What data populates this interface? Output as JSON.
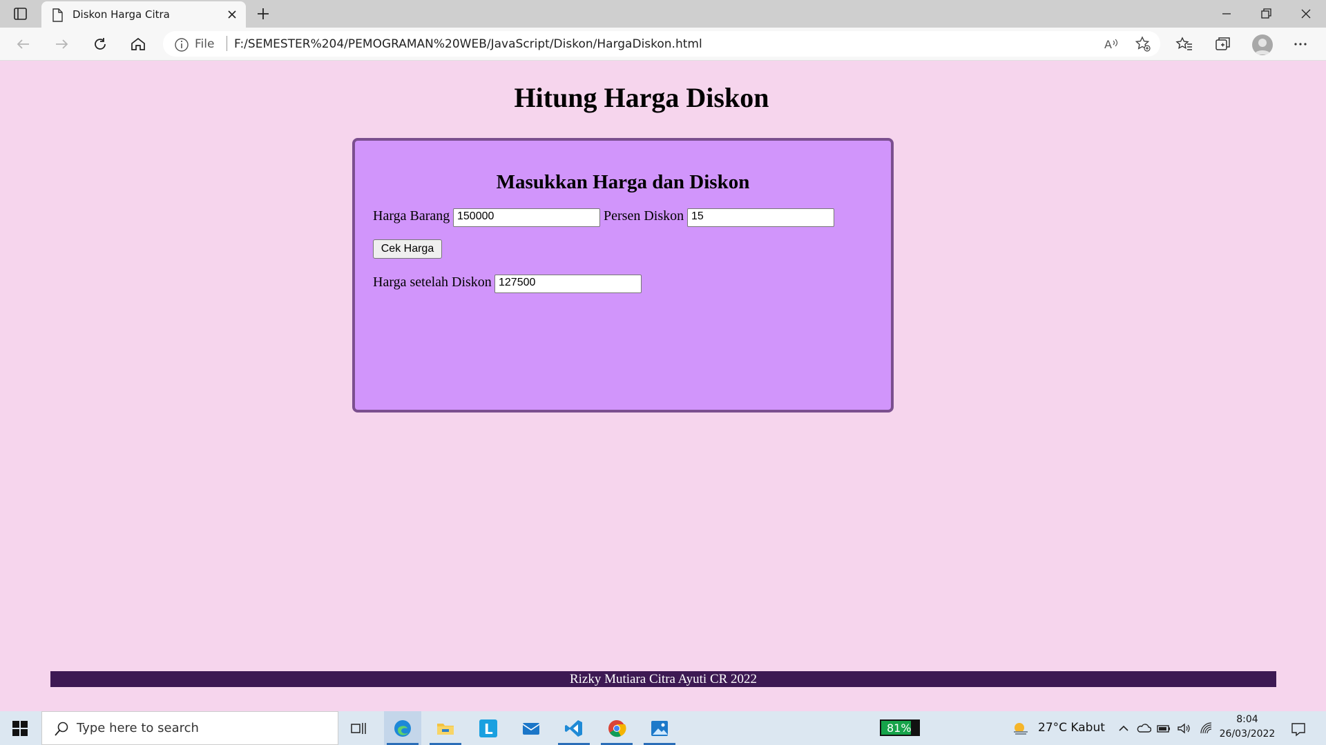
{
  "browser": {
    "tab_title": "Diskon Harga Citra",
    "address_prefix": "File",
    "url": "F:/SEMESTER%204/PEMOGRAMAN%20WEB/JavaScript/Diskon/HargaDiskon.html"
  },
  "page": {
    "heading": "Hitung Harga Diskon",
    "panel_title": "Masukkan Harga dan Diskon",
    "price_label": "Harga Barang",
    "price_value": "150000",
    "discount_label": "Persen Diskon",
    "discount_value": "15",
    "button_label": "Cek Harga",
    "result_label": "Harga setelah Diskon",
    "result_value": "127500",
    "footer": "Rizky Mutiara Citra Ayuti CR 2022"
  },
  "taskbar": {
    "search_placeholder": "Type here to search",
    "battery": "81%",
    "weather": "27°C  Kabut",
    "time": "8:04",
    "date": "26/03/2022"
  },
  "colors": {
    "page_bg": "#f6d5ed",
    "panel_bg": "#d195fb",
    "panel_border": "#7b4f8f",
    "footer_bg": "#3d1953"
  }
}
